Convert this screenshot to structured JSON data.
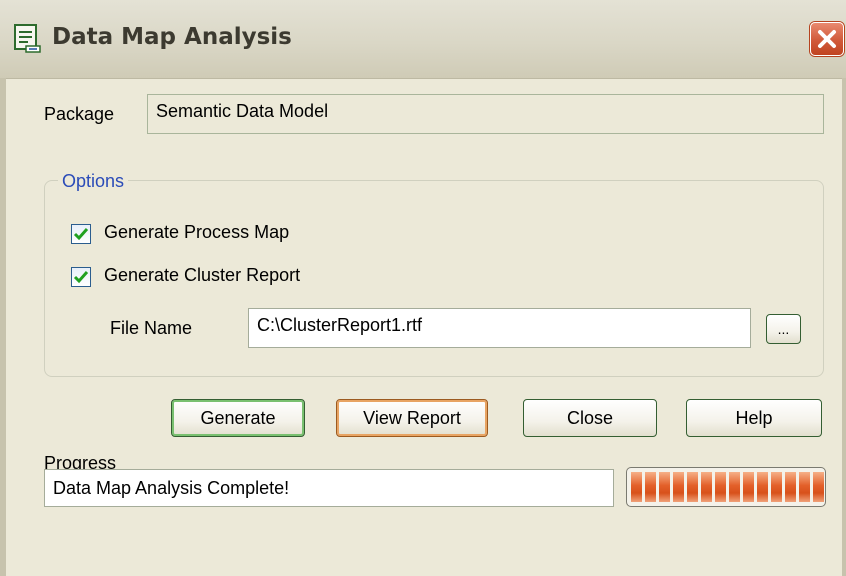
{
  "window": {
    "title": "Data Map Analysis",
    "app_icon": "document-map-icon",
    "close_icon": "close-icon"
  },
  "package": {
    "label": "Package",
    "value": "Semantic Data Model"
  },
  "options": {
    "legend": "Options",
    "generate_process_map": {
      "label": "Generate Process Map",
      "checked": true
    },
    "generate_cluster_report": {
      "label": "Generate Cluster Report",
      "checked": true
    },
    "file_name": {
      "label": "File Name",
      "value": "C:\\ClusterReport1.rtf",
      "browse_label": "..."
    }
  },
  "buttons": {
    "generate": "Generate",
    "view_report": "View Report",
    "close": "Close",
    "help": "Help"
  },
  "progress": {
    "label": "Progress",
    "status": "Data Map Analysis Complete!",
    "fraction": 1.0,
    "segments": 14,
    "color": "#e3602a"
  },
  "colors": {
    "dialog_bg": "#ece9d8",
    "accent_blue": "#2a4bb8",
    "check_green": "#21a121",
    "close_red": "#d15a3a"
  }
}
